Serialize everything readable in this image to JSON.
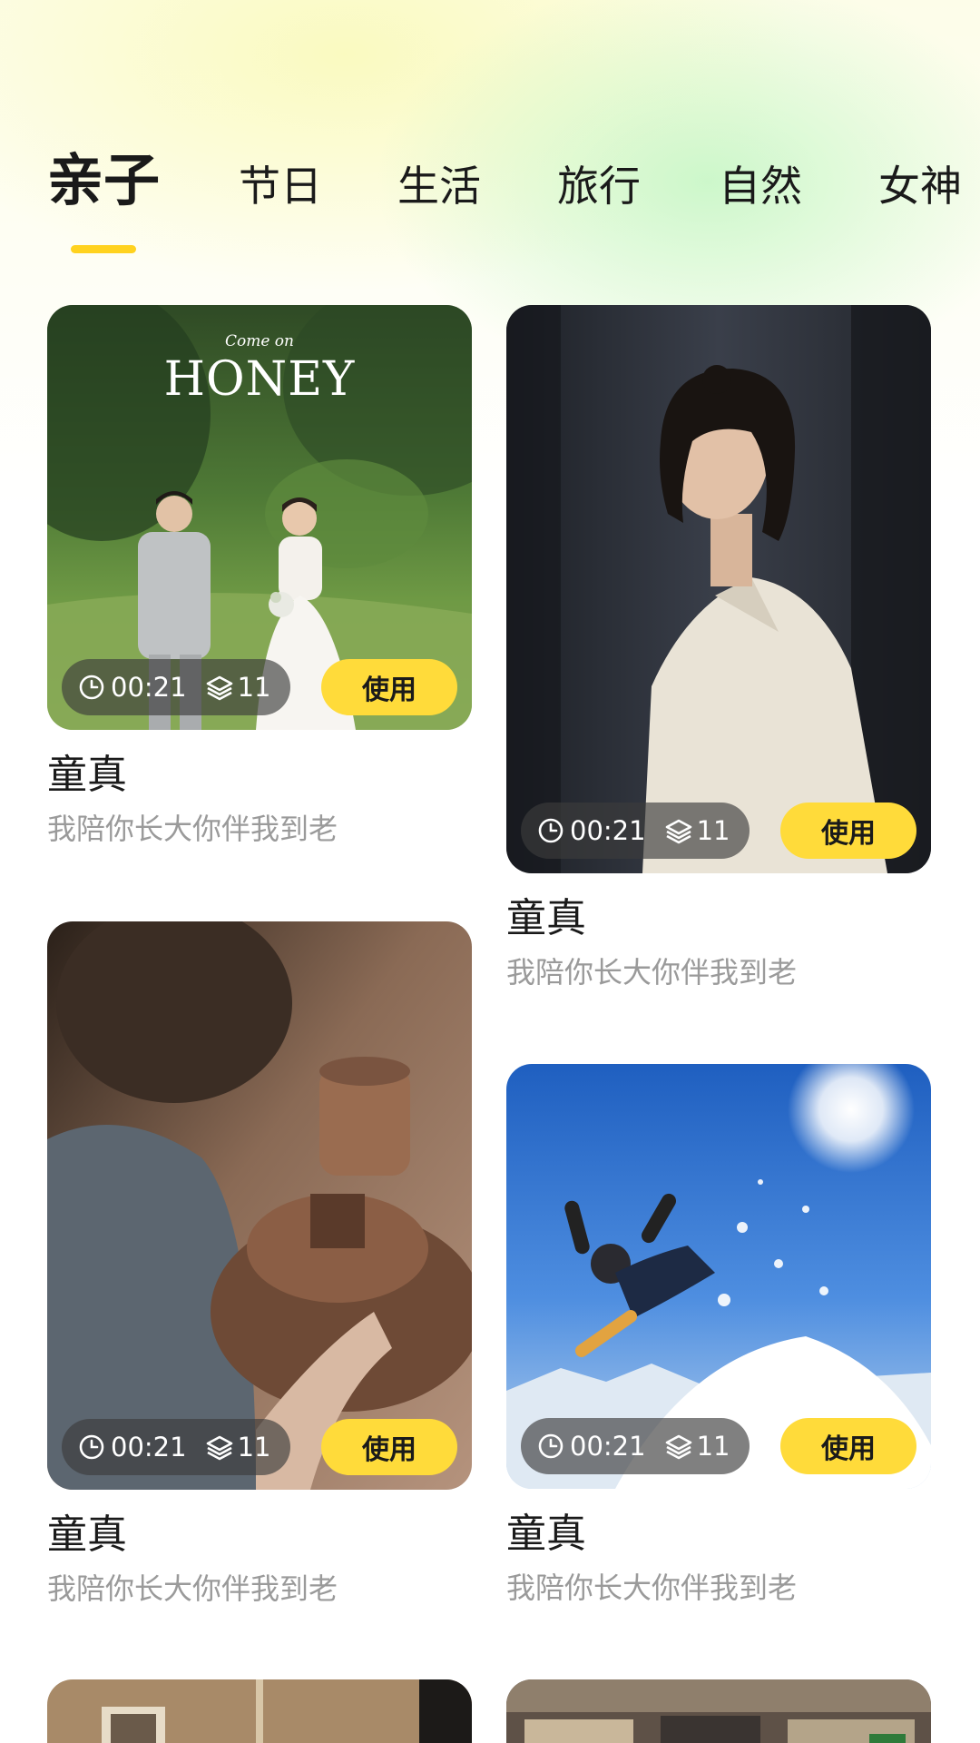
{
  "tabs": [
    {
      "label": "亲子",
      "active": true
    },
    {
      "label": "节日",
      "active": false
    },
    {
      "label": "生活",
      "active": false
    },
    {
      "label": "旅行",
      "active": false
    },
    {
      "label": "自然",
      "active": false
    },
    {
      "label": "女神",
      "active": false
    }
  ],
  "colors": {
    "accent": "#ffd21f",
    "use_button": "#ffdb3a",
    "subtitle": "#9a9a9a"
  },
  "cards": [
    {
      "overlay_text": {
        "line1": "Come on",
        "line2": "HONEY"
      },
      "duration": "00:21",
      "layers": "11",
      "use_label": "使用",
      "title": "童真",
      "subtitle": "我陪你长大你伴我到老"
    },
    {
      "duration": "00:21",
      "layers": "11",
      "use_label": "使用",
      "title": "童真",
      "subtitle": "我陪你长大你伴我到老"
    },
    {
      "duration": "00:21",
      "layers": "11",
      "use_label": "使用",
      "title": "童真",
      "subtitle": "我陪你长大你伴我到老"
    },
    {
      "duration": "00:21",
      "layers": "11",
      "use_label": "使用",
      "title": "童真",
      "subtitle": "我陪你长大你伴我到老"
    }
  ],
  "icons": {
    "duration": "clock-icon",
    "layers": "layers-icon"
  }
}
